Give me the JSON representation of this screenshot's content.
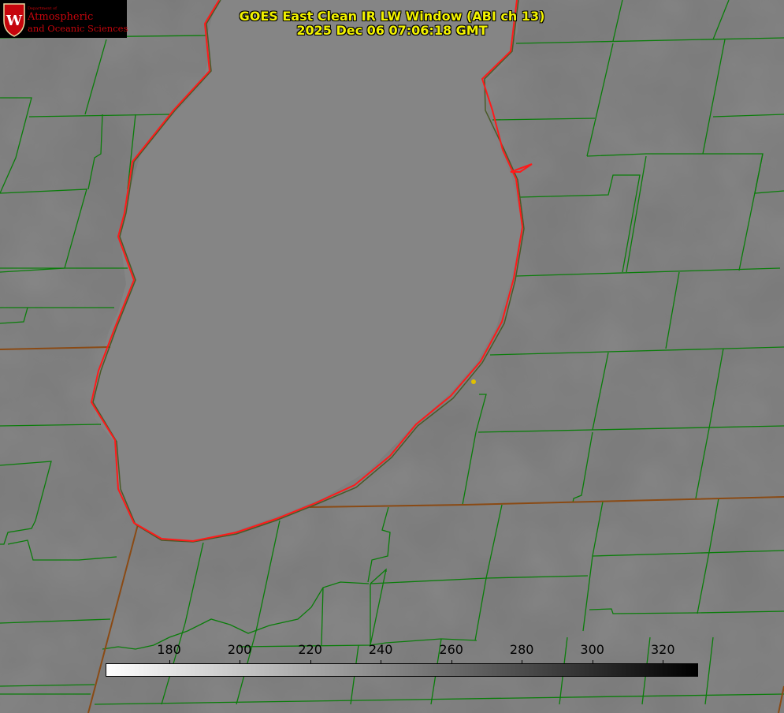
{
  "logo": {
    "department": "Department of",
    "line1": "Atmospheric",
    "line2": "and Oceanic Sciences",
    "crest_letter": "W",
    "color": "#c5050c"
  },
  "title": {
    "line1": "GOES East Clean IR LW Window (ABI ch 13)",
    "line2": "2025 Dec 06 07:06:18 GMT",
    "color": "#f2f200"
  },
  "colorbar": {
    "ticks": [
      "180",
      "200",
      "220",
      "240",
      "260",
      "280",
      "300",
      "320"
    ],
    "tick_values": [
      180,
      200,
      220,
      240,
      260,
      280,
      300,
      320
    ],
    "range": [
      162,
      330
    ],
    "colormap": "white-to-black"
  },
  "map": {
    "county_line_color": "#0a7d0a",
    "coastline_color": "#ff1a1a",
    "state_line_color": "#8a4a14",
    "marker_color": "#e0c000"
  }
}
